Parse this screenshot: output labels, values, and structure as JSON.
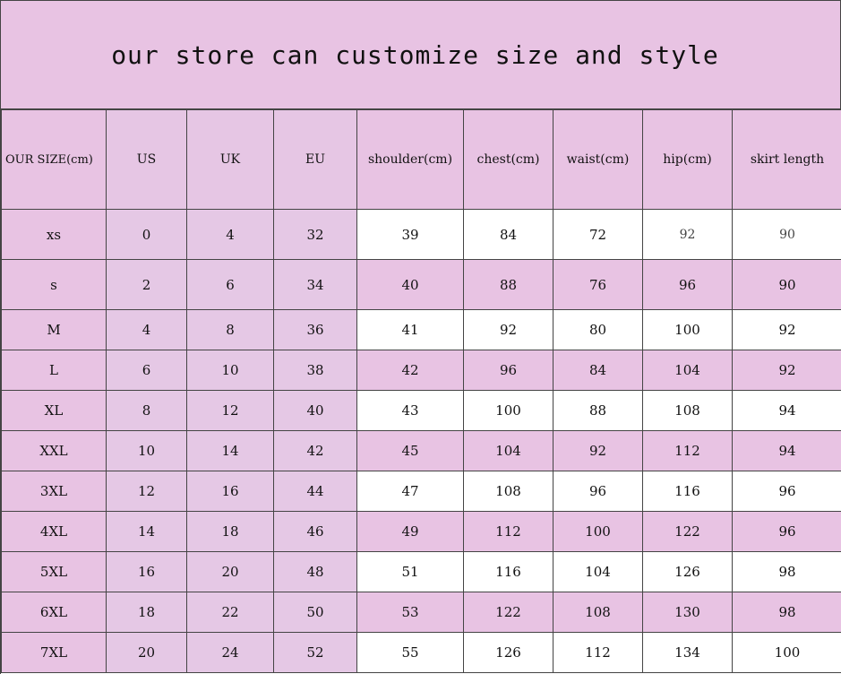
{
  "title": "our store can customize size and style",
  "headers": {
    "size": "OUR SIZE(cm)",
    "us": "US",
    "uk": "UK",
    "eu": "EU",
    "shoulder": "shoulder(cm)",
    "chest": "chest(cm)",
    "waist": "waist(cm)",
    "hip": "hip(cm)",
    "skirt": "skirt length"
  },
  "colors": {
    "pink": "#e8c3e3",
    "lavender": "#e5c8e5",
    "white": "#ffffff",
    "border": "#444444"
  },
  "rows": [
    {
      "size": "xs",
      "us": "0",
      "uk": "4",
      "eu": "32",
      "shoulder": "39",
      "chest": "84",
      "waist": "72",
      "hip": "92",
      "skirt": "90"
    },
    {
      "size": "s",
      "us": "2",
      "uk": "6",
      "eu": "34",
      "shoulder": "40",
      "chest": "88",
      "waist": "76",
      "hip": "96",
      "skirt": "90"
    },
    {
      "size": "M",
      "us": "4",
      "uk": "8",
      "eu": "36",
      "shoulder": "41",
      "chest": "92",
      "waist": "80",
      "hip": "100",
      "skirt": "92"
    },
    {
      "size": "L",
      "us": "6",
      "uk": "10",
      "eu": "38",
      "shoulder": "42",
      "chest": "96",
      "waist": "84",
      "hip": "104",
      "skirt": "92"
    },
    {
      "size": "XL",
      "us": "8",
      "uk": "12",
      "eu": "40",
      "shoulder": "43",
      "chest": "100",
      "waist": "88",
      "hip": "108",
      "skirt": "94"
    },
    {
      "size": "XXL",
      "us": "10",
      "uk": "14",
      "eu": "42",
      "shoulder": "45",
      "chest": "104",
      "waist": "92",
      "hip": "112",
      "skirt": "94"
    },
    {
      "size": "3XL",
      "us": "12",
      "uk": "16",
      "eu": "44",
      "shoulder": "47",
      "chest": "108",
      "waist": "96",
      "hip": "116",
      "skirt": "96"
    },
    {
      "size": "4XL",
      "us": "14",
      "uk": "18",
      "eu": "46",
      "shoulder": "49",
      "chest": "112",
      "waist": "100",
      "hip": "122",
      "skirt": "96"
    },
    {
      "size": "5XL",
      "us": "16",
      "uk": "20",
      "eu": "48",
      "shoulder": "51",
      "chest": "116",
      "waist": "104",
      "hip": "126",
      "skirt": "98"
    },
    {
      "size": "6XL",
      "us": "18",
      "uk": "22",
      "eu": "50",
      "shoulder": "53",
      "chest": "122",
      "waist": "108",
      "hip": "130",
      "skirt": "98"
    },
    {
      "size": "7XL",
      "us": "20",
      "uk": "24",
      "eu": "52",
      "shoulder": "55",
      "chest": "126",
      "waist": "112",
      "hip": "134",
      "skirt": "100"
    }
  ]
}
